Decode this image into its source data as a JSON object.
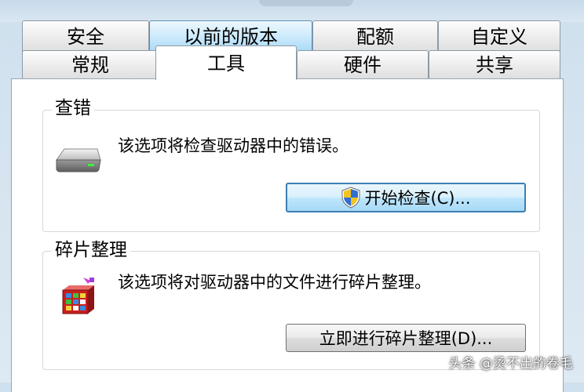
{
  "tabs_row1": [
    {
      "label": "安全",
      "state": "normal"
    },
    {
      "label": "以前的版本",
      "state": "hover"
    },
    {
      "label": "配额",
      "state": "normal"
    },
    {
      "label": "自定义",
      "state": "normal"
    }
  ],
  "tabs_row2": [
    {
      "label": "常规",
      "state": "normal"
    },
    {
      "label": "工具",
      "state": "active"
    },
    {
      "label": "硬件",
      "state": "normal"
    },
    {
      "label": "共享",
      "state": "normal"
    }
  ],
  "error_check": {
    "title": "查错",
    "description": "该选项将检查驱动器中的错误。",
    "button_label": "开始检查(C)..."
  },
  "defrag": {
    "title": "碎片整理",
    "description": "该选项将对驱动器中的文件进行碎片整理。",
    "button_label": "立即进行碎片整理(D)..."
  },
  "watermark": "头条 @烫不出的卷毛",
  "icons": {
    "drive": "hard-drive-icon",
    "shield": "uac-shield-icon",
    "defrag": "defrag-icon"
  },
  "colors": {
    "hover_tab": "#c9e9fb",
    "default_button_border": "#3c7fb1"
  }
}
